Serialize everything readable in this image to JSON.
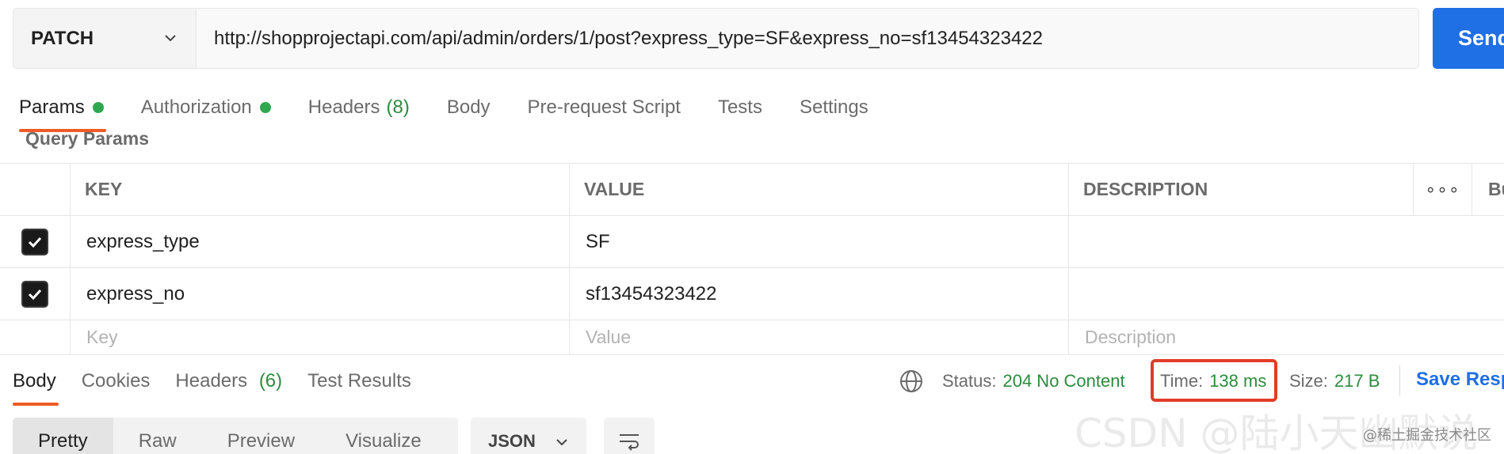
{
  "request": {
    "method": "PATCH",
    "url": "http://shopprojectapi.com/api/admin/orders/1/post?express_type=SF&express_no=sf13454323422",
    "send_label": "Send"
  },
  "request_tabs": [
    {
      "label": "Params",
      "dot": true,
      "active": true
    },
    {
      "label": "Authorization",
      "dot": true
    },
    {
      "label": "Headers",
      "count": "(8)"
    },
    {
      "label": "Body"
    },
    {
      "label": "Pre-request Script"
    },
    {
      "label": "Tests"
    },
    {
      "label": "Settings"
    }
  ],
  "query_params": {
    "title": "Query Params",
    "columns": [
      "KEY",
      "VALUE",
      "DESCRIPTION",
      "Bu"
    ],
    "rows": [
      {
        "checked": true,
        "key": "express_type",
        "value": "SF",
        "description": ""
      },
      {
        "checked": true,
        "key": "express_no",
        "value": "sf13454323422",
        "description": ""
      }
    ],
    "placeholders": {
      "key": "Key",
      "value": "Value",
      "description": "Description"
    }
  },
  "response": {
    "tabs": [
      {
        "label": "Body",
        "active": true
      },
      {
        "label": "Cookies"
      },
      {
        "label": "Headers",
        "count": "(6)"
      },
      {
        "label": "Test Results"
      }
    ],
    "status_label": "Status:",
    "status_value": "204 No Content",
    "time_label": "Time:",
    "time_value": "138 ms",
    "size_label": "Size:",
    "size_value": "217 B",
    "save_label": "Save Resp",
    "views": [
      "Pretty",
      "Raw",
      "Preview",
      "Visualize"
    ],
    "format": "JSON"
  },
  "watermark": {
    "big": "CSDN @陆小天幽默说",
    "small": "@稀土掘金技术社区"
  },
  "colors": {
    "accent_orange": "#ef5b25",
    "send_blue": "#1f6fe5",
    "status_green": "#2d8b3e",
    "highlight_red": "#e23b2a"
  }
}
